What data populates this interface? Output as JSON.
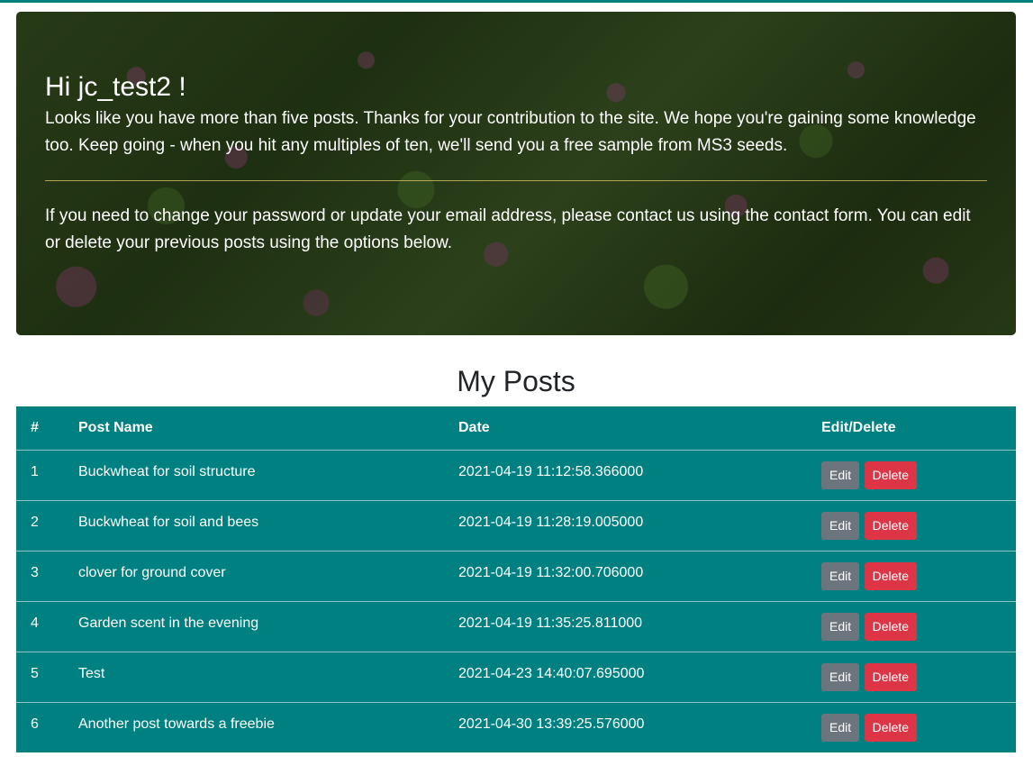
{
  "colors": {
    "accent": "#008080",
    "edit_button": "#6c757d",
    "delete_button": "#dc3545"
  },
  "hero": {
    "greeting": "Hi jc_test2 !",
    "message": "Looks like you have more than five posts. Thanks for your contribution to the site. We hope you're gaining some knowledge too. Keep going - when you hit any multiples of ten, we'll send you a free sample from MS3 seeds.",
    "instructions": "If you need to change your password or update your email address, please contact us using the contact form. You can edit or delete your previous posts using the options below."
  },
  "posts": {
    "title": "My Posts",
    "headers": {
      "num": "#",
      "name": "Post Name",
      "date": "Date",
      "actions": "Edit/Delete"
    },
    "edit_label": "Edit",
    "delete_label": "Delete",
    "rows": [
      {
        "num": "1",
        "name": "Buckwheat for soil structure",
        "date": "2021-04-19 11:12:58.366000"
      },
      {
        "num": "2",
        "name": "Buckwheat for soil and bees",
        "date": "2021-04-19 11:28:19.005000"
      },
      {
        "num": "3",
        "name": "clover for ground cover",
        "date": "2021-04-19 11:32:00.706000"
      },
      {
        "num": "4",
        "name": "Garden scent in the evening",
        "date": "2021-04-19 11:35:25.811000"
      },
      {
        "num": "5",
        "name": "Test",
        "date": "2021-04-23 14:40:07.695000"
      },
      {
        "num": "6",
        "name": "Another post towards a freebie",
        "date": "2021-04-30 13:39:25.576000"
      }
    ]
  }
}
